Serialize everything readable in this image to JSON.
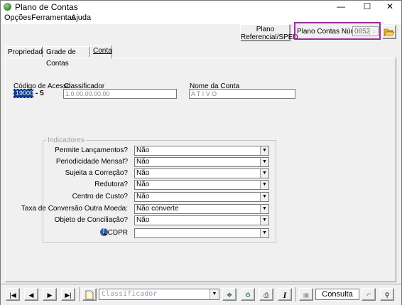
{
  "window": {
    "title": "Plano de Contas",
    "minimize": "—",
    "maximize": "☐",
    "close": "✕"
  },
  "menu": {
    "items": [
      "Opções",
      "Ferramentas",
      "Ajuda"
    ]
  },
  "toolbar": {
    "plano_button_line1": "Plano",
    "plano_button_line2": "Referencial/SPED",
    "plano_contas_numero_label": "Plano Contas Número",
    "plano_contas_numero_value": "0852",
    "folder_icon": "open-folder-icon"
  },
  "tabs": [
    "Propriedades",
    "Grade de Contas",
    "Conta"
  ],
  "active_tab": "Conta",
  "conta": {
    "codigo_label": "Código de Acesso",
    "codigo_value": "19000",
    "digito": "- 5",
    "classificador_label": "Classificador",
    "classificador_value": "1.0.00.00.00.00",
    "nome_label": "Nome da Conta",
    "nome_value": "A T I V O"
  },
  "indicadores": {
    "title": "Indicadores",
    "rows": [
      {
        "label": "Permite Lançamentos?",
        "value": "Não"
      },
      {
        "label": "Periodicidade Mensal?",
        "value": "Não"
      },
      {
        "label": "Sujeita a Correção?",
        "value": "Não"
      },
      {
        "label": "Redutora?",
        "value": "Não"
      },
      {
        "label": "Centro de Custo?",
        "value": "Não"
      },
      {
        "label": "Taxa de Conversão Outra Moeda:",
        "value": "Não converte"
      },
      {
        "label": "Objeto de Conciliação?",
        "value": "Não"
      },
      {
        "label": "LCDPR",
        "value": ""
      }
    ]
  },
  "bottom": {
    "classificador_placeholder": "Classificador",
    "mode": "Consulta",
    "nav": [
      "first-icon",
      "prev-icon",
      "next-icon",
      "last-icon"
    ]
  },
  "colors": {
    "highlight_border": "#9b2d9b",
    "selection": "#0a3a8a"
  }
}
